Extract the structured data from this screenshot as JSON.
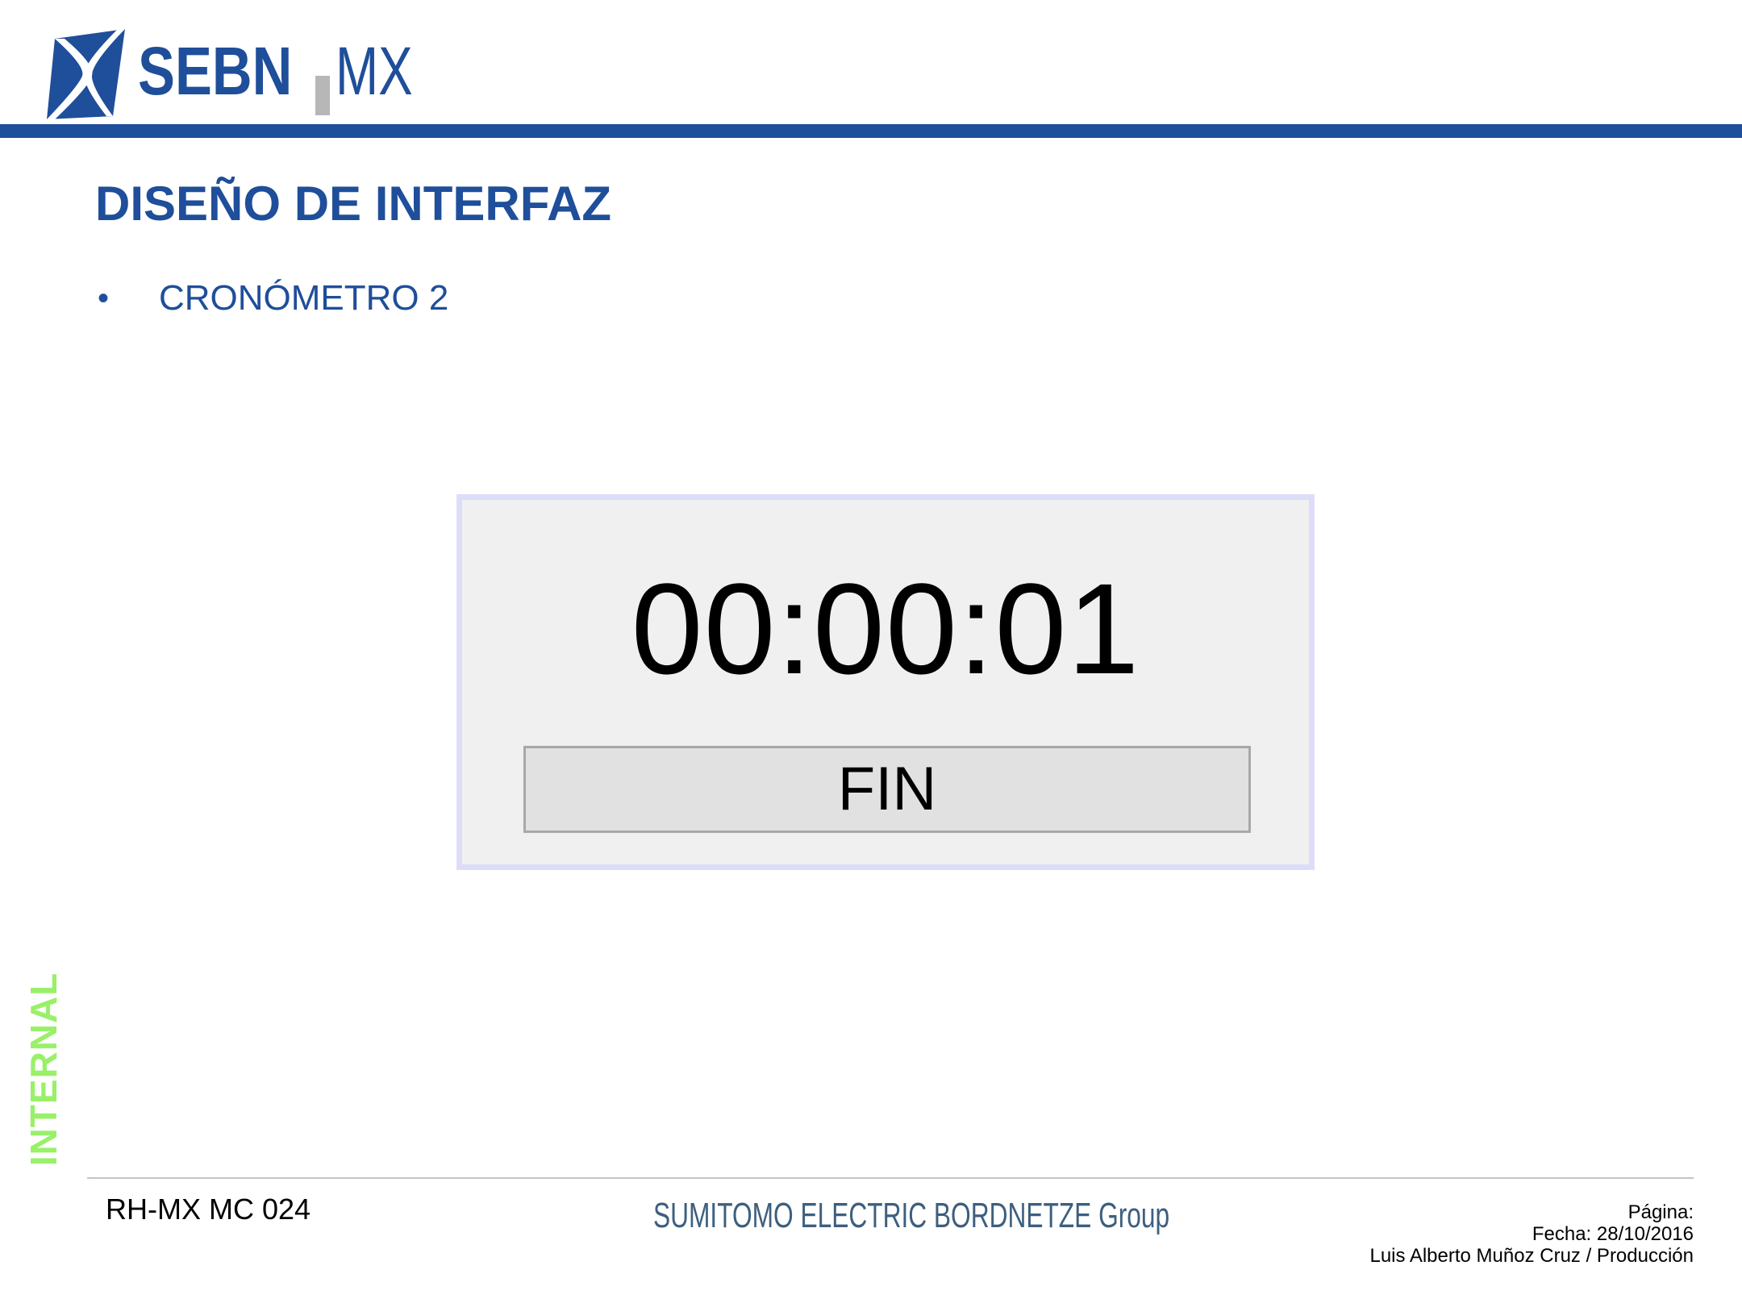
{
  "header": {
    "logo": {
      "brand_primary": "SEBN",
      "brand_secondary": "MX",
      "colors": {
        "blue": "#1f4e9a",
        "gray": "#b7b7b7"
      }
    },
    "band_color": "#1f4e9a"
  },
  "slide": {
    "title": "DISEÑO DE INTERFAZ",
    "bullets": [
      {
        "marker": "•",
        "text": "CRONÓMETRO 2"
      }
    ]
  },
  "timer_window": {
    "display_value": "00:00:01",
    "button_label": "FIN",
    "colors": {
      "frame": "#ddddfa",
      "background": "#f0f0f0",
      "button": "#e1e1e1"
    }
  },
  "classification": {
    "label": "INTERNAL",
    "color": "#99f069"
  },
  "footer": {
    "document_code": "RH-MX MC 024",
    "brand": "SUMITOMO ELECTRIC BORDNETZE Group",
    "page_label": "Página:",
    "date_label": "Fecha: 28/10/2016",
    "author": "Luis Alberto Muñoz Cruz / Producción"
  }
}
